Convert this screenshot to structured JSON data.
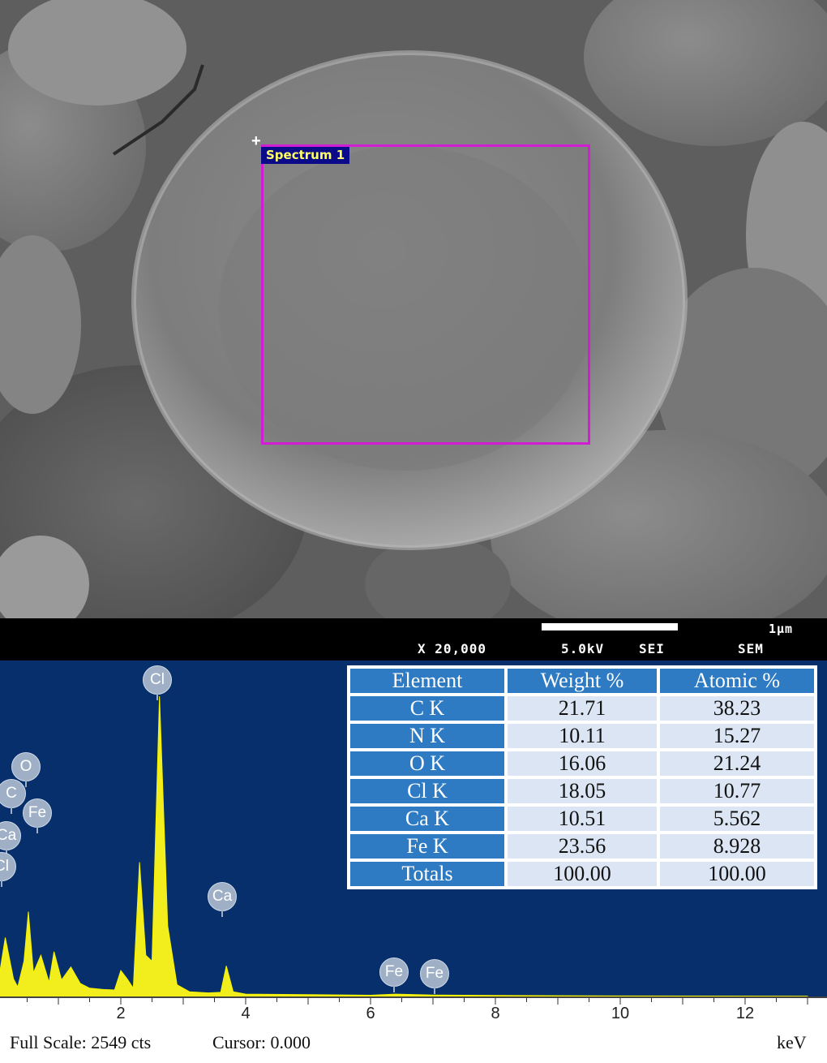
{
  "roi": {
    "label": "Spectrum 1"
  },
  "info_bar": {
    "scale_label": "1µm",
    "magnification": "X 20,000",
    "voltage": "5.0kV",
    "detector": "SEI",
    "instrument": "SEM"
  },
  "peak_labels": [
    "Cl",
    "O",
    "C",
    "Fe",
    "Ca",
    "Cl",
    "Ca",
    "Fe",
    "Fe"
  ],
  "table": {
    "headers": [
      "Element",
      "Weight %",
      "Atomic %"
    ],
    "rows": [
      [
        "C K",
        "21.71",
        "38.23"
      ],
      [
        "N K",
        "10.11",
        "15.27"
      ],
      [
        "O K",
        "16.06",
        "21.24"
      ],
      [
        "Cl K",
        "18.05",
        "10.77"
      ],
      [
        "Ca K",
        "10.51",
        "5.562"
      ],
      [
        "Fe K",
        "23.56",
        "8.928"
      ],
      [
        "Totals",
        "100.00",
        "100.00"
      ]
    ]
  },
  "chart_data": {
    "type": "line",
    "xlabel": "keV",
    "xlim": [
      0,
      13.2
    ],
    "x_ticks": [
      "2",
      "4",
      "6",
      "8",
      "10",
      "12"
    ],
    "series": [
      {
        "x": [
          0.0,
          0.15,
          0.28,
          0.35,
          0.45,
          0.52,
          0.6,
          0.72,
          0.85,
          0.93,
          1.05,
          1.2,
          1.35,
          1.5,
          1.7,
          1.9,
          2.0,
          2.1,
          2.2,
          2.3,
          2.4,
          2.5,
          2.62,
          2.75,
          2.9,
          3.1,
          3.4,
          3.6,
          3.69,
          3.8,
          4.0,
          5.0,
          6.0,
          6.4,
          7.0,
          8.0,
          9.5,
          13.0
        ],
        "y": [
          0,
          500,
          150,
          80,
          300,
          720,
          200,
          350,
          120,
          380,
          140,
          250,
          110,
          70,
          60,
          55,
          220,
          150,
          70,
          1140,
          350,
          300,
          2549,
          600,
          100,
          40,
          30,
          35,
          260,
          40,
          20,
          15,
          10,
          20,
          12,
          8,
          5,
          3
        ]
      }
    ]
  },
  "footer": {
    "full_scale": "Full Scale: 2549 cts",
    "cursor": "Cursor: 0.000",
    "unit": "keV"
  }
}
